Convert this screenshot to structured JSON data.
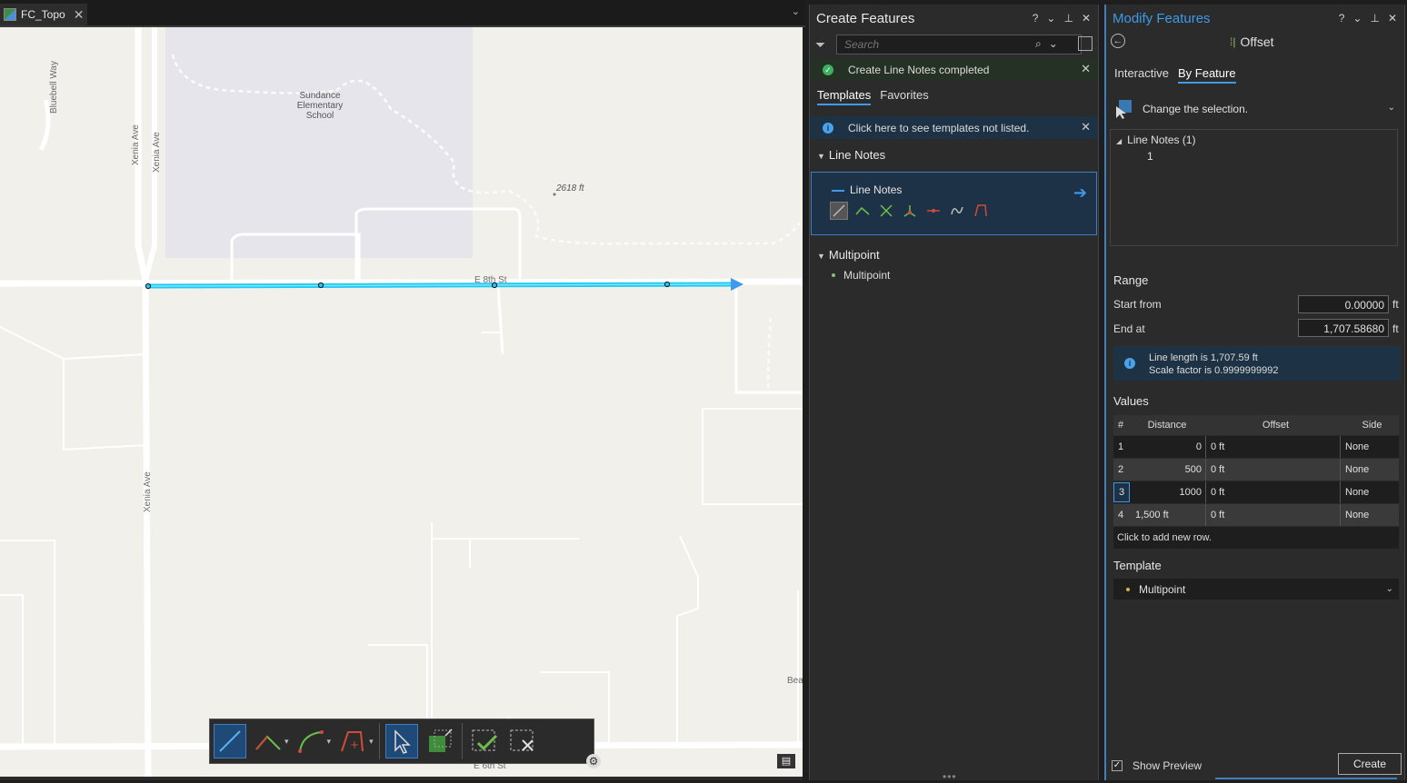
{
  "map_tab": {
    "label": "FC_Topo"
  },
  "map": {
    "labels": {
      "bluebell": "Bluebell Way",
      "xenia1": "Xenia Ave",
      "xenia2": "Xenia Ave",
      "xenia3": "Xenia Ave",
      "school": "Sundance Elementary School",
      "elevation": "2618 ft",
      "e8th": "E 8th St",
      "e6th": "E 6th St",
      "bea": "Bea"
    },
    "feature_color": "#1ec8f0"
  },
  "create_features": {
    "title": "Create Features",
    "search_placeholder": "Search",
    "success_message": "Create Line Notes completed",
    "tabs": [
      "Templates",
      "Favorites"
    ],
    "info_message": "Click here to see templates not listed.",
    "groups": [
      {
        "name": "Line Notes",
        "template": "Line Notes"
      },
      {
        "name": "Multipoint",
        "template": "Multipoint"
      }
    ]
  },
  "modify_features": {
    "title": "Modify Features",
    "tool_name": "Offset",
    "tabs": [
      "Interactive",
      "By Feature"
    ],
    "selection_prompt": "Change the selection.",
    "tree": {
      "root": "Line Notes (1)",
      "child": "1"
    },
    "range": {
      "header": "Range",
      "start_label": "Start from",
      "start_value": "0.00000",
      "end_label": "End at",
      "end_value": "1,707.58680",
      "unit": "ft"
    },
    "info": {
      "line1": "Line length is 1,707.59 ft",
      "line2": "Scale factor is 0.9999999992"
    },
    "values": {
      "header": "Values",
      "columns": [
        "#",
        "Distance",
        "Offset",
        "Side"
      ],
      "rows": [
        {
          "idx": "1",
          "distance": "0",
          "offset": "0 ft",
          "side": "None"
        },
        {
          "idx": "2",
          "distance": "500",
          "offset": "0 ft",
          "side": "None"
        },
        {
          "idx": "3",
          "distance": "1000",
          "offset": "0 ft",
          "side": "None"
        },
        {
          "idx": "4",
          "distance": "1,500 ft",
          "offset": "0 ft",
          "side": "None"
        }
      ],
      "add_row": "Click to add new row."
    },
    "template": {
      "header": "Template",
      "value": "Multipoint"
    },
    "show_preview": "Show Preview",
    "create_button": "Create"
  }
}
